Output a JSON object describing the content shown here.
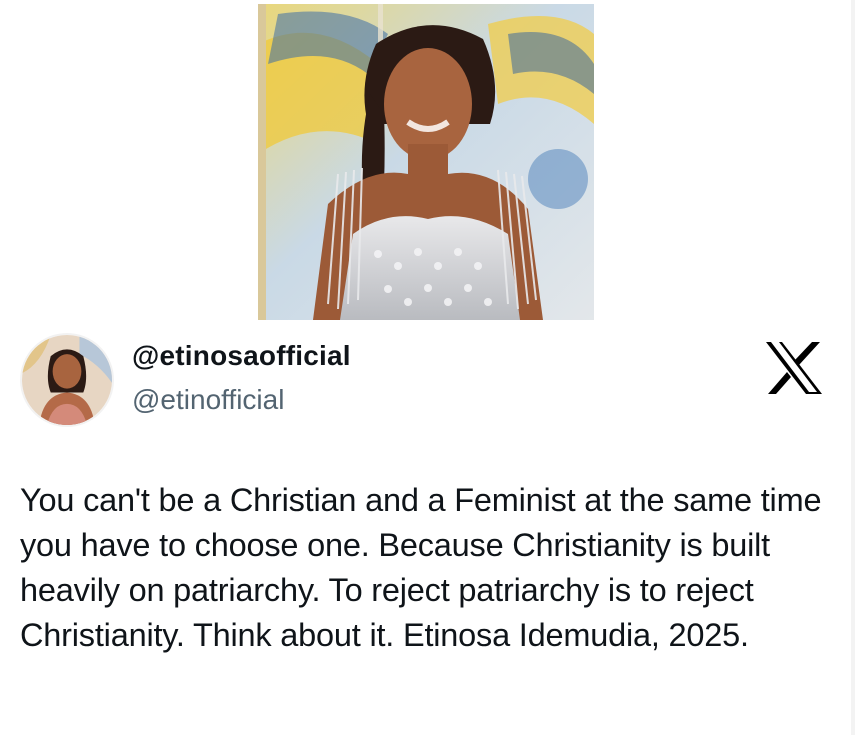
{
  "post": {
    "display_name": "@etinosaofficial",
    "handle": "@etinofficial",
    "text": "You can't be a Christian and a Feminist at the same time you have to choose one. Because Christianity is built heavily on patriarchy. To reject patriarchy is to reject Christianity. Think about it. Etinosa Idemudia, 2025."
  },
  "icons": {
    "platform_logo": "x-logo-icon"
  },
  "colors": {
    "text_primary": "#0f1419",
    "text_secondary": "#536471",
    "background": "#ffffff"
  }
}
